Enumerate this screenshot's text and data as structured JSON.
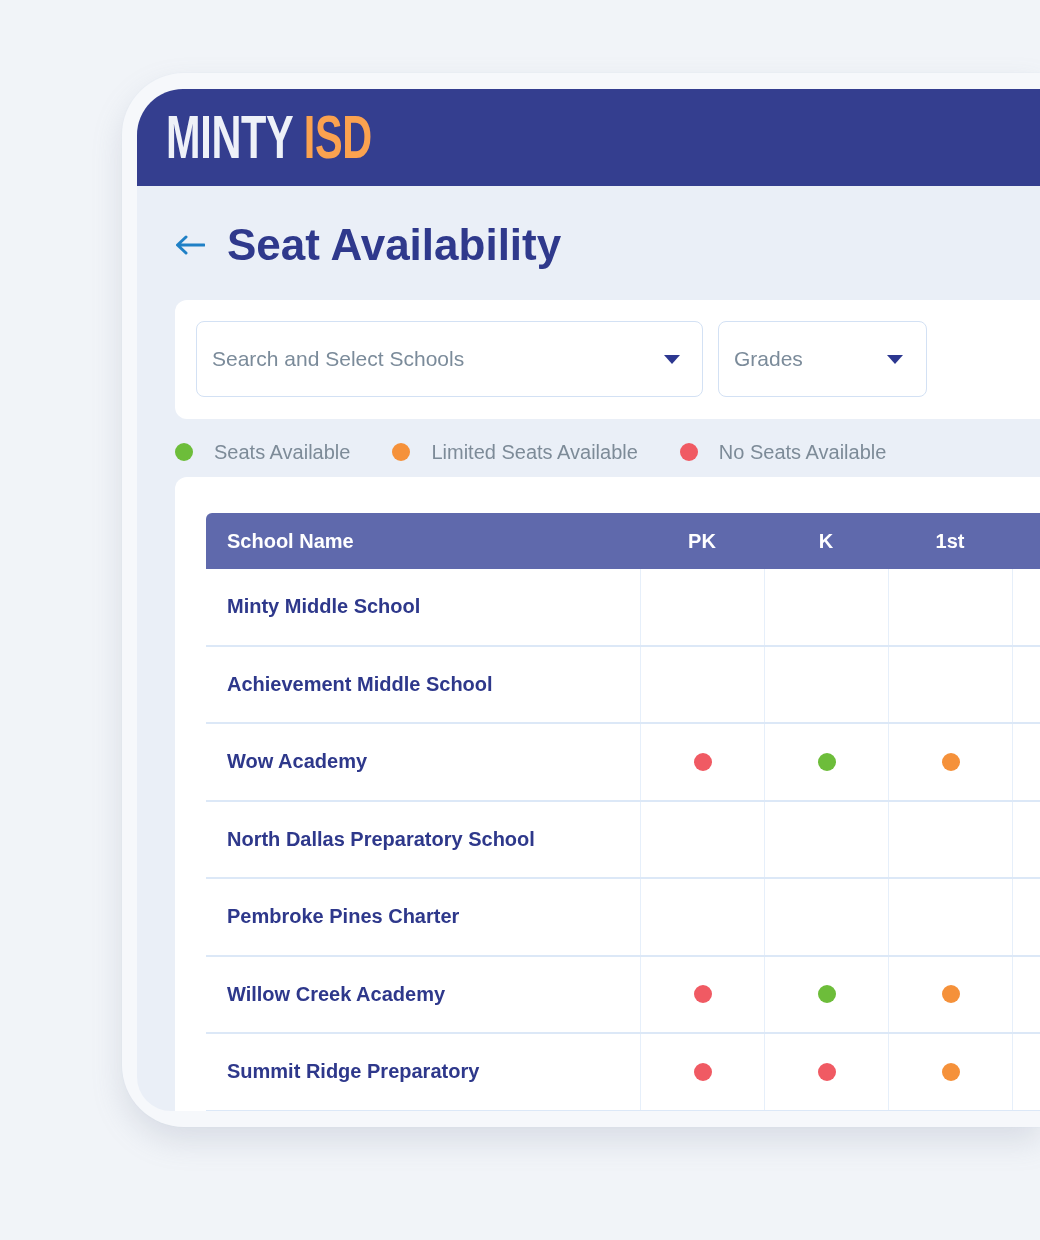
{
  "header": {
    "logo": {
      "primary": "MINTY",
      "accent": "ISD"
    }
  },
  "page": {
    "title": "Seat Availability"
  },
  "filters": [
    {
      "kind": "schools",
      "placeholder": "Search and Select Schools"
    },
    {
      "kind": "grades",
      "placeholder": "Grades"
    }
  ],
  "legend": [
    {
      "label": "Seats Available",
      "color": "#6dbd3a"
    },
    {
      "label": "Limited Seats Available",
      "color": "#f5913a"
    },
    {
      "label": "No Seats Available",
      "color": "#f05a63"
    }
  ],
  "table": {
    "columns": [
      "School Name",
      "PK",
      "K",
      "1st"
    ],
    "rows": [
      {
        "school": "Minty Middle School",
        "cells": [
          {
            "kind": "empty"
          },
          {
            "kind": "empty"
          },
          {
            "kind": "empty"
          }
        ]
      },
      {
        "school": "Achievement Middle School",
        "cells": [
          {
            "kind": "empty"
          },
          {
            "kind": "empty"
          },
          {
            "kind": "empty"
          }
        ]
      },
      {
        "school": "Wow Academy",
        "cells": [
          {
            "kind": "dot",
            "color": "#f05a63"
          },
          {
            "kind": "dot",
            "color": "#6dbd3a"
          },
          {
            "kind": "dot",
            "color": "#f5913a"
          }
        ]
      },
      {
        "school": "North Dallas Preparatory School",
        "cells": [
          {
            "kind": "empty"
          },
          {
            "kind": "empty"
          },
          {
            "kind": "empty"
          }
        ]
      },
      {
        "school": "Pembroke Pines Charter",
        "cells": [
          {
            "kind": "empty"
          },
          {
            "kind": "empty"
          },
          {
            "kind": "empty"
          }
        ]
      },
      {
        "school": "Willow Creek Academy",
        "cells": [
          {
            "kind": "dot",
            "color": "#f05a63"
          },
          {
            "kind": "dot",
            "color": "#6dbd3a"
          },
          {
            "kind": "dot",
            "color": "#f5913a"
          }
        ]
      },
      {
        "school": "Summit Ridge Preparatory",
        "cells": [
          {
            "kind": "dot",
            "color": "#f05a63"
          },
          {
            "kind": "dot",
            "color": "#f05a63"
          },
          {
            "kind": "dot",
            "color": "#f5913a"
          }
        ]
      }
    ]
  }
}
